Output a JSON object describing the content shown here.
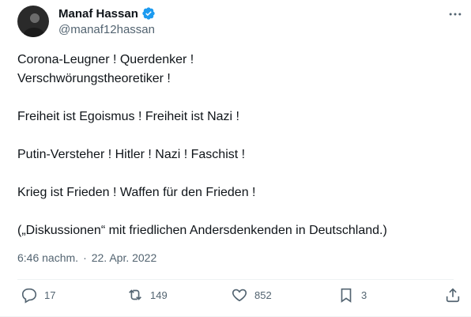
{
  "author": {
    "name": "Manaf Hassan",
    "handle": "@manaf12hassan",
    "avatar_icon": "avatar-photo",
    "verified_color": "#1d9bf0"
  },
  "tweet": {
    "lines": [
      "Corona-Leugner ! Querdenker !",
      "Verschwörungstheoretiker !",
      "",
      "Freiheit ist Egoismus ! Freiheit ist Nazi !",
      "",
      "Putin-Versteher ! Hitler ! Nazi ! Faschist !",
      "",
      "Krieg ist Frieden ! Waffen für den Frieden !",
      "",
      "(„Diskussionen“ mit friedlichen Andersdenkenden in Deutschland.)"
    ],
    "time": "6:46 nachm.",
    "separator": "·",
    "date": "22. Apr. 2022"
  },
  "actions": {
    "replies": "17",
    "retweets": "149",
    "likes": "852",
    "bookmarks": "3"
  },
  "colors": {
    "text": "#0f1419",
    "secondary": "#536471",
    "accent": "#1d9bf0"
  }
}
